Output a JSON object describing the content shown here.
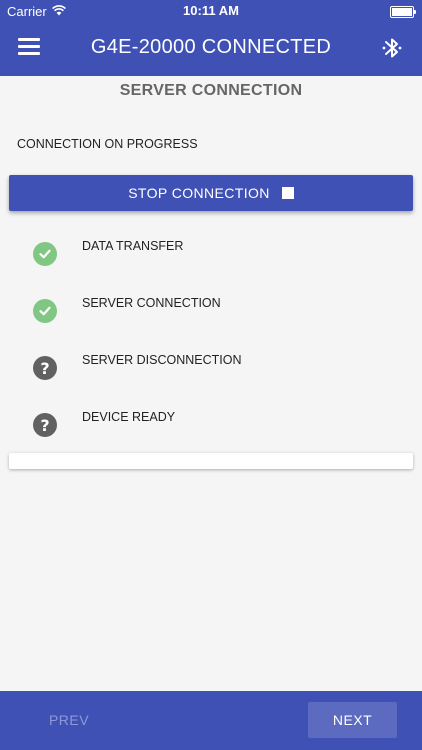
{
  "status_bar": {
    "carrier": "Carrier",
    "time": "10:11 AM"
  },
  "appbar": {
    "title": "G4E-20000 CONNECTED",
    "menu_icon": "hamburger-menu-icon",
    "bluetooth_icon": "bluetooth-icon"
  },
  "section": {
    "title": "SERVER CONNECTION",
    "status": "CONNECTION ON PROGRESS"
  },
  "stop_button": {
    "label": "STOP CONNECTION"
  },
  "steps": [
    {
      "label": "DATA TRANSFER",
      "state": "done",
      "icon": "check-circle-icon"
    },
    {
      "label": "SERVER CONNECTION",
      "state": "done",
      "icon": "check-circle-icon"
    },
    {
      "label": "SERVER DISCONNECTION",
      "state": "unknown",
      "icon": "help-circle-icon"
    },
    {
      "label": "DEVICE READY",
      "state": "unknown",
      "icon": "help-circle-icon"
    }
  ],
  "footer": {
    "prev_label": "PREV",
    "next_label": "NEXT"
  },
  "colors": {
    "primary": "#3f51b5",
    "success": "#81c784",
    "unknown": "#616161",
    "next_button": "#5c6bc0"
  }
}
